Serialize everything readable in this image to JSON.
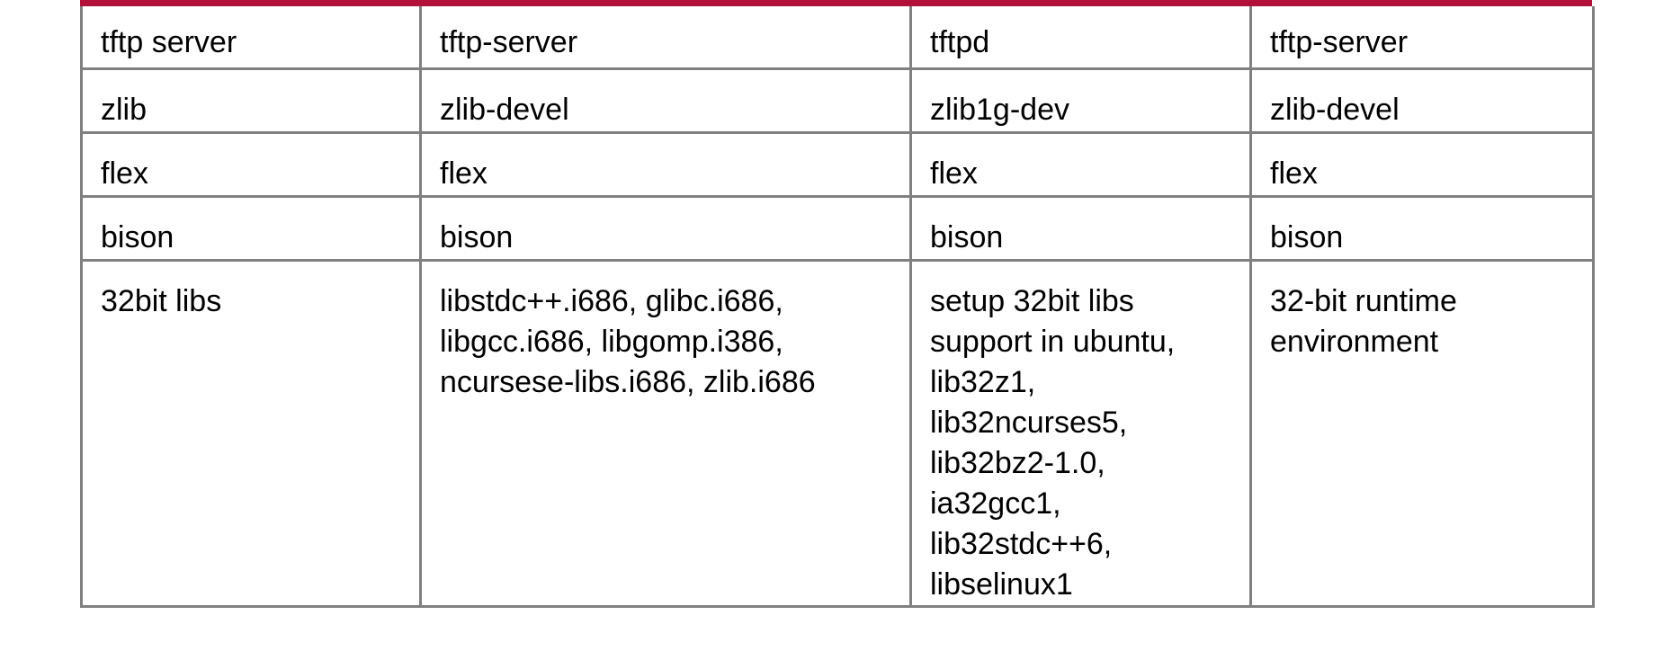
{
  "accent_color": "#b0103a",
  "border_color": "#808080",
  "rows": [
    {
      "cells": [
        "tftp server",
        "tftp-server",
        "tftpd",
        "tftp-server"
      ]
    },
    {
      "cells": [
        "zlib",
        "zlib-devel",
        "zlib1g-dev",
        "zlib-devel"
      ]
    },
    {
      "cells": [
        "flex",
        "flex",
        "flex",
        "flex"
      ]
    },
    {
      "cells": [
        "bison",
        "bison",
        "bison",
        "bison"
      ]
    },
    {
      "cells": [
        "32bit libs",
        "libstdc++.i686, glibc.i686,\nlibgcc.i686, libgomp.i386,\nncursese-libs.i686, zlib.i686",
        "setup 32bit libs\nsupport in ubuntu,\nlib32z1,\nlib32ncurses5,\nlib32bz2-1.0,\nia32gcc1,\nlib32stdc++6,\nlibselinux1",
        "32-bit runtime\nenvironment"
      ]
    }
  ]
}
